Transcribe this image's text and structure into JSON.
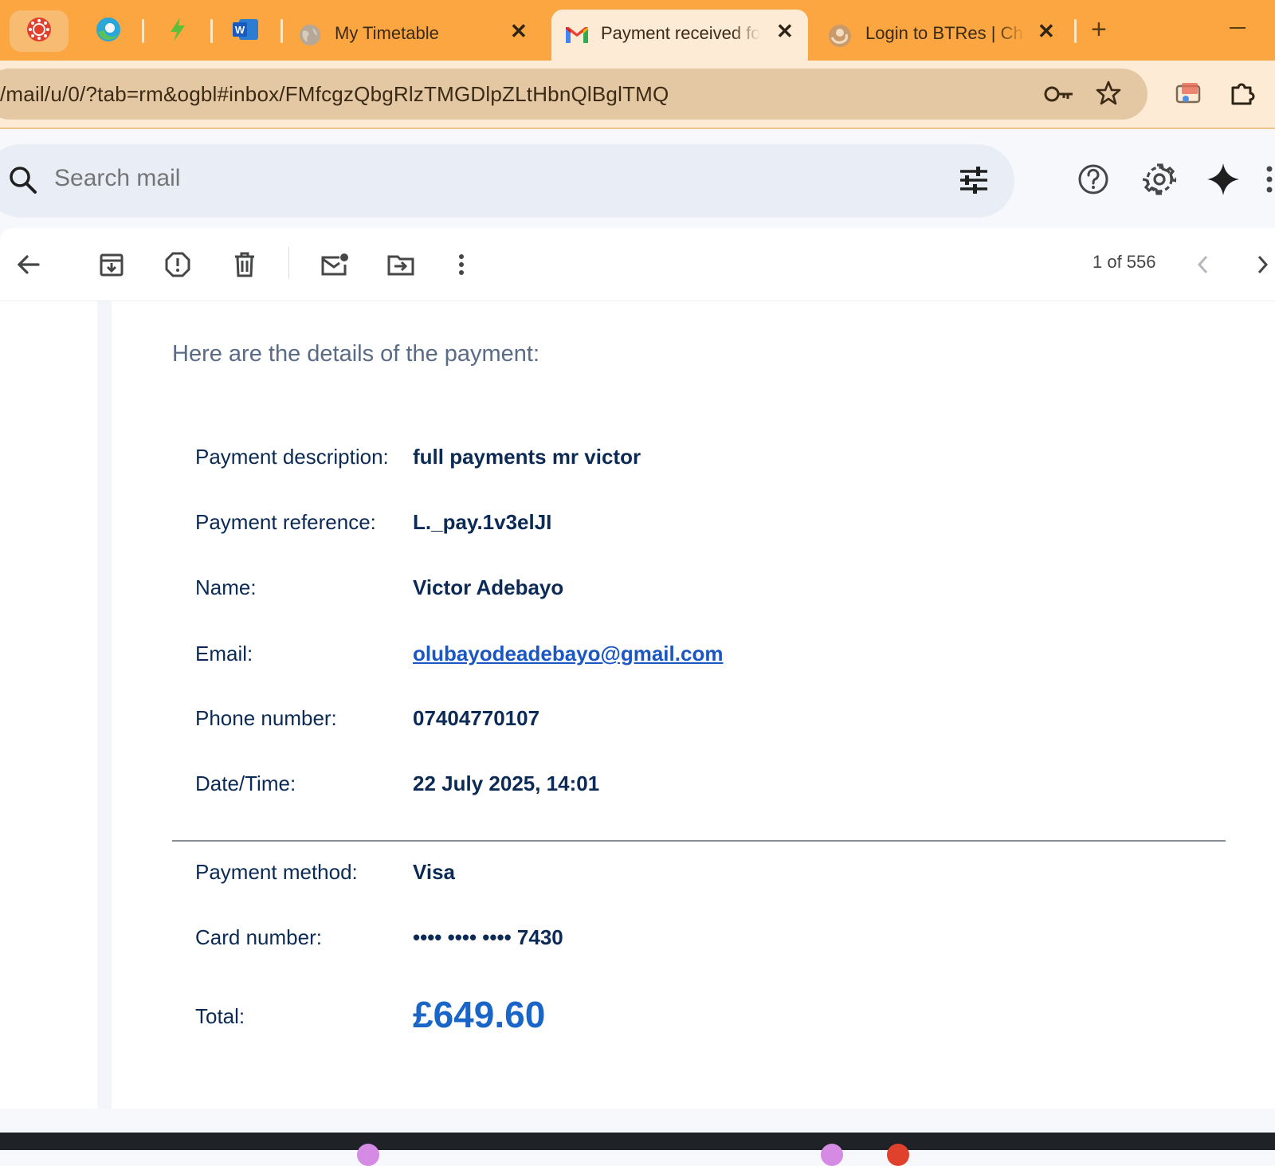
{
  "browser": {
    "tabs": [
      {
        "title": "My Timetable",
        "close": "✕"
      },
      {
        "title": "Payment received fo",
        "close": "✕"
      },
      {
        "title": "Login to BTRes | Ch",
        "close": "✕"
      }
    ],
    "new_tab": "+",
    "url": "/mail/u/0/?tab=rm&ogbl#inbox/FMfcgzQbgRlzTMGDlpZLtHbnQlBglTMQ"
  },
  "gmail": {
    "search_placeholder": "Search mail",
    "pager": "1 of 556"
  },
  "email": {
    "intro": "Here are the details of the payment:",
    "details": [
      {
        "label": "Payment description:",
        "value": "full payments mr victor"
      },
      {
        "label": "Payment reference:",
        "value": "L._pay.1v3elJI"
      },
      {
        "label": "Name:",
        "value": "Victor Adebayo"
      },
      {
        "label": "Email:",
        "value": "olubayodeadebayo@gmail.com"
      },
      {
        "label": "Phone number:",
        "value": "07404770107"
      },
      {
        "label": "Date/Time:",
        "value": "22 July 2025, 14:01"
      }
    ],
    "payment": [
      {
        "label": "Payment method:",
        "value": "Visa"
      },
      {
        "label": "Card number:",
        "value": "•••• •••• •••• 7430"
      }
    ],
    "total": {
      "label": "Total:",
      "value": "£649.60"
    }
  },
  "colors": {
    "tab_strip": "#fba640",
    "link": "#1a56c4",
    "total": "#1a66c8"
  }
}
